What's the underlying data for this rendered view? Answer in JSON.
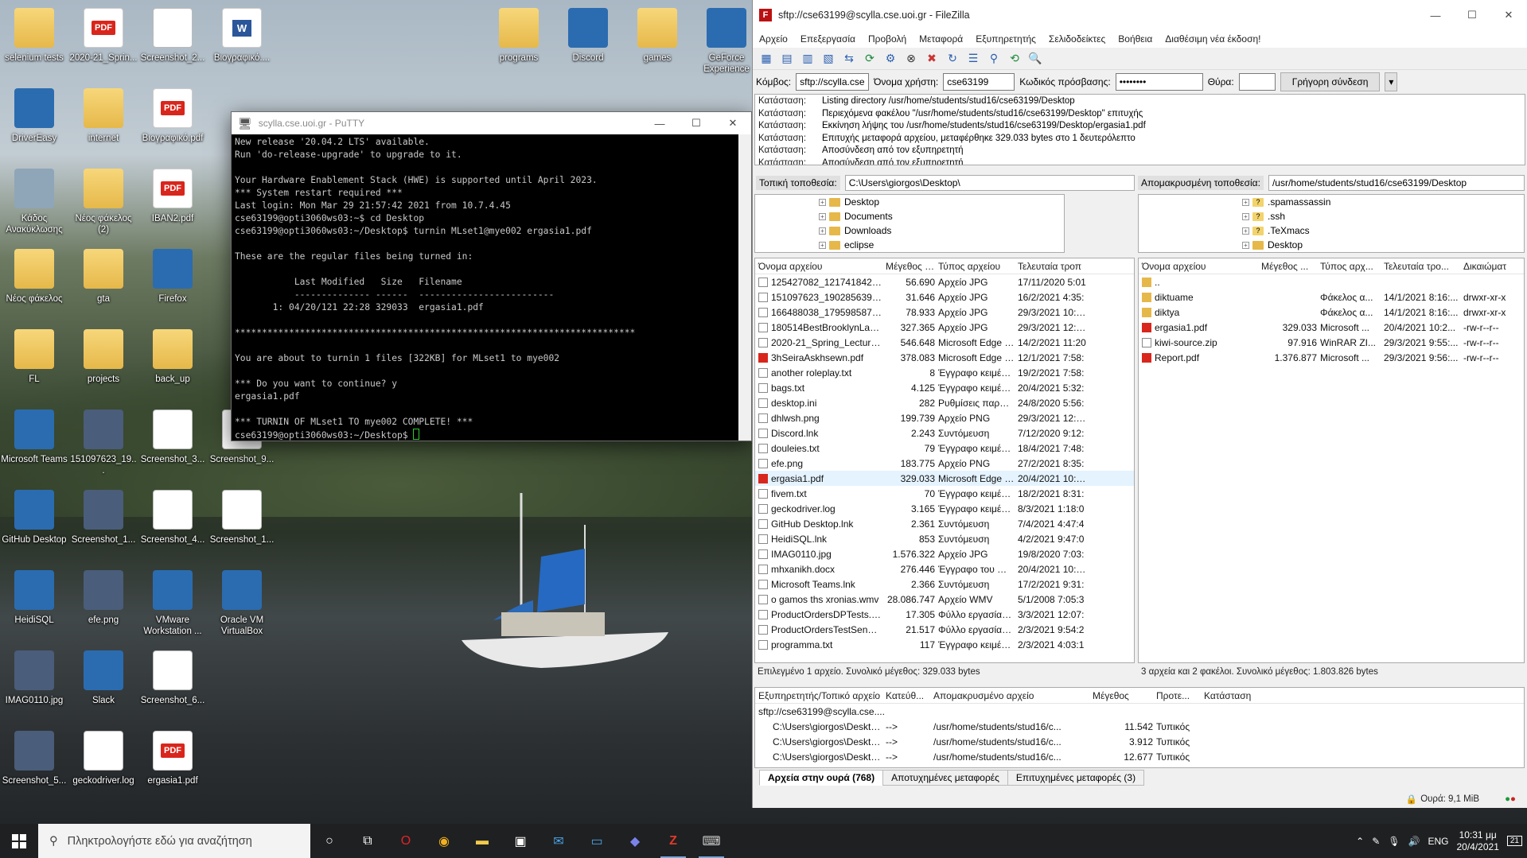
{
  "desktop": {
    "icons": [
      {
        "label": "selenium tests",
        "type": "folder"
      },
      {
        "label": "2020-21_Sprin...",
        "type": "pdf"
      },
      {
        "label": "Screenshot_2...",
        "type": "doc"
      },
      {
        "label": "Βιογραφικό....",
        "type": "word"
      },
      {
        "label": "programs",
        "type": "folder"
      },
      {
        "label": "Discord",
        "type": "app"
      },
      {
        "label": "games",
        "type": "folder"
      },
      {
        "label": "GeForce Experience",
        "type": "app"
      },
      {
        "label": "DriverEasy",
        "type": "app"
      },
      {
        "label": "internet",
        "type": "folder"
      },
      {
        "label": "Βιογραφικό.pdf",
        "type": "pdf"
      },
      {
        "label": "Κάδος Ανακύκλωσης",
        "type": "bin"
      },
      {
        "label": "Νέος φάκελος (2)",
        "type": "folder"
      },
      {
        "label": "IBAN2.pdf",
        "type": "pdf"
      },
      {
        "label": "Νέος φάκελος",
        "type": "folder"
      },
      {
        "label": "gta",
        "type": "folder"
      },
      {
        "label": "Firefox",
        "type": "app"
      },
      {
        "label": "FL",
        "type": "folder"
      },
      {
        "label": "projects",
        "type": "folder"
      },
      {
        "label": "back_up",
        "type": "folder"
      },
      {
        "label": "Microsoft Teams",
        "type": "app"
      },
      {
        "label": "151097623_19...",
        "type": "img"
      },
      {
        "label": "Screenshot_3...",
        "type": "doc"
      },
      {
        "label": "Screenshot_9...",
        "type": "doc"
      },
      {
        "label": "GitHub Desktop",
        "type": "app"
      },
      {
        "label": "Screenshot_1...",
        "type": "img"
      },
      {
        "label": "Screenshot_4...",
        "type": "doc"
      },
      {
        "label": "Screenshot_1...",
        "type": "doc"
      },
      {
        "label": "HeidiSQL",
        "type": "app"
      },
      {
        "label": "efe.png",
        "type": "img"
      },
      {
        "label": "VMware Workstation ...",
        "type": "app"
      },
      {
        "label": "Oracle VM VirtualBox",
        "type": "app"
      },
      {
        "label": "IMAG0110.jpg",
        "type": "img"
      },
      {
        "label": "Slack",
        "type": "app"
      },
      {
        "label": "Screenshot_6...",
        "type": "doc"
      },
      {
        "label": "Screenshot_5...",
        "type": "img"
      },
      {
        "label": "geckodriver.log",
        "type": "doc"
      },
      {
        "label": "ergasia1.pdf",
        "type": "pdf"
      }
    ]
  },
  "putty": {
    "title": "scylla.cse.uoi.gr - PuTTY",
    "lines": [
      "New release '20.04.2 LTS' available.",
      "Run 'do-release-upgrade' to upgrade to it.",
      "",
      "Your Hardware Enablement Stack (HWE) is supported until April 2023.",
      "*** System restart required ***",
      "Last login: Mon Mar 29 21:57:42 2021 from 10.7.4.45",
      "cse63199@opti3060ws03:~$ cd Desktop",
      "cse63199@opti3060ws03:~/Desktop$ turnin MLset1@mye002 ergasia1.pdf",
      "",
      "These are the regular files being turned in:",
      "",
      "           Last Modified   Size   Filename",
      "           -------------- ------  -------------------------",
      "       1: 04/20/121 22:28 329033  ergasia1.pdf",
      "",
      "**************************************************************************",
      "",
      "You are about to turnin 1 files [322KB] for MLset1 to mye002",
      "",
      "*** Do you want to continue? y",
      "ergasia1.pdf",
      "",
      "*** TURNIN OF MLset1 TO mye002 COMPLETE! ***"
    ],
    "prompt": "cse63199@opti3060ws03:~/Desktop$ "
  },
  "filezilla": {
    "title": "sftp://cse63199@scylla.cse.uoi.gr - FileZilla",
    "menu": [
      "Αρχείο",
      "Επεξεργασία",
      "Προβολή",
      "Μεταφορά",
      "Εξυπηρετητής",
      "Σελιδοδείκτες",
      "Βοήθεια",
      "Διαθέσιμη νέα έκδοση!"
    ],
    "quickconnect": {
      "host_label": "Κόμβος:",
      "host_value": "sftp://scylla.cse.uoi",
      "user_label": "Όνομα χρήστη:",
      "user_value": "cse63199",
      "pass_label": "Κωδικός πρόσβασης:",
      "pass_value": "••••••••",
      "port_label": "Θύρα:",
      "port_value": "",
      "button": "Γρήγορη σύνδεση"
    },
    "log": [
      [
        "Κατάσταση:",
        "Listing directory /usr/home/students/stud16/cse63199/Desktop"
      ],
      [
        "Κατάσταση:",
        "Περιεχόμενα φακέλου \"/usr/home/students/stud16/cse63199/Desktop\" επιτυχής"
      ],
      [
        "Κατάσταση:",
        "Εκκίνηση λήψης του /usr/home/students/stud16/cse63199/Desktop/ergasia1.pdf"
      ],
      [
        "Κατάσταση:",
        "Επιτυχής μεταφορά αρχείου, μεταφέρθηκε 329.033 bytes στο 1 δευτερόλεπτο"
      ],
      [
        "Κατάσταση:",
        "Αποσύνδεση από τον εξυπηρετητή"
      ],
      [
        "Κατάσταση:",
        "Αποσύνδεση από τον εξυπηρετητή"
      ]
    ],
    "local": {
      "path_label": "Τοπική τοποθεσία:",
      "path": "C:\\Users\\giorgos\\Desktop\\",
      "tree": [
        "Desktop",
        "Documents",
        "Downloads",
        "eclipse"
      ],
      "headers": [
        "Όνομα αρχείου",
        "Μέγεθος α...",
        "Τύπος αρχείου",
        "Τελευταία τροπ"
      ],
      "files": [
        [
          "125427082_1217418425306...",
          "56.690",
          "Αρχείο JPG",
          "17/11/2020 5:01"
        ],
        [
          "151097623_1902856393198...",
          "31.646",
          "Αρχείο JPG",
          "16/2/2021 4:35:"
        ],
        [
          "166488038_1795985870593...",
          "78.933",
          "Αρχείο JPG",
          "29/3/2021 10:23"
        ],
        [
          "180514BestBrooklynLandl...",
          "327.365",
          "Αρχείο JPG",
          "29/3/2021 12:45"
        ],
        [
          "2020-21_Spring_Lectures-...",
          "546.648",
          "Microsoft Edge PD...",
          "14/2/2021 11:20"
        ],
        [
          "3hSeiraAskhsewn.pdf",
          "378.083",
          "Microsoft Edge PD...",
          "12/1/2021 7:58:"
        ],
        [
          "another roleplay.txt",
          "8",
          "Έγγραφο κειμένου",
          "19/2/2021 7:58:"
        ],
        [
          "bags.txt",
          "4.125",
          "Έγγραφο κειμένου",
          "20/4/2021 5:32:"
        ],
        [
          "desktop.ini",
          "282",
          "Ρυθμίσεις παραμέ...",
          "24/8/2020 5:56:"
        ],
        [
          "dhlwsh.png",
          "199.739",
          "Αρχείο PNG",
          "29/3/2021 12:25"
        ],
        [
          "Discord.lnk",
          "2.243",
          "Συντόμευση",
          "7/12/2020 9:12:"
        ],
        [
          "douleies.txt",
          "79",
          "Έγγραφο κειμένου",
          "18/4/2021 7:48:"
        ],
        [
          "efe.png",
          "183.775",
          "Αρχείο PNG",
          "27/2/2021 8:35:"
        ],
        [
          "ergasia1.pdf",
          "329.033",
          "Microsoft Edge PD...",
          "20/4/2021 10:28"
        ],
        [
          "fivem.txt",
          "70",
          "Έγγραφο κειμένου",
          "18/2/2021 8:31:"
        ],
        [
          "geckodriver.log",
          "3.165",
          "Έγγραφο κειμένου",
          "8/3/2021 1:18:0"
        ],
        [
          "GitHub Desktop.lnk",
          "2.361",
          "Συντόμευση",
          "7/4/2021 4:47:4"
        ],
        [
          "HeidiSQL.lnk",
          "853",
          "Συντόμευση",
          "4/2/2021 9:47:0"
        ],
        [
          "IMAG0110.jpg",
          "1.576.322",
          "Αρχείο JPG",
          "19/8/2020 7:03:"
        ],
        [
          "mhxanikh.docx",
          "276.446",
          "Έγγραφο του Micr...",
          "20/4/2021 10:14"
        ],
        [
          "Microsoft Teams.lnk",
          "2.366",
          "Συντόμευση",
          "17/2/2021 9:31:"
        ],
        [
          "o gamos ths xronias.wmv",
          "28.086.747",
          "Αρχείο WMV",
          "5/1/2008 7:05:3"
        ],
        [
          "ProductOrdersDPTests.xlsx",
          "17.305",
          "Φύλλο εργασίας τ...",
          "3/3/2021 12:07:"
        ],
        [
          "ProductOrdersTestSenario...",
          "21.517",
          "Φύλλο εργασίας τ...",
          "2/3/2021 9:54:2"
        ],
        [
          "programma.txt",
          "117",
          "Έγγραφο κειμένου",
          "2/3/2021 4:03:1"
        ]
      ],
      "status": "Επιλεγμένο 1 αρχείο. Συνολικό μέγεθος: 329.033 bytes"
    },
    "remote": {
      "path_label": "Απομακρυσμένη τοποθεσία:",
      "path": "/usr/home/students/stud16/cse63199/Desktop",
      "tree": [
        ".spamassassin",
        ".ssh",
        ".TeXmacs",
        "Desktop"
      ],
      "headers": [
        "Όνομα αρχείου",
        "Μέγεθος ...",
        "Τύπος αρχ...",
        "Τελευταία τρο...",
        "Δικαιώματ"
      ],
      "files": [
        [
          "..",
          "",
          "",
          "",
          ""
        ],
        [
          "diktuame",
          "",
          "Φάκελος α...",
          "14/1/2021 8:16:...",
          "drwxr-xr-x"
        ],
        [
          "diktya",
          "",
          "Φάκελος α...",
          "14/1/2021 8:16:...",
          "drwxr-xr-x"
        ],
        [
          "ergasia1.pdf",
          "329.033",
          "Microsoft ...",
          "20/4/2021 10:2...",
          "-rw-r--r--"
        ],
        [
          "kiwi-source.zip",
          "97.916",
          "WinRAR ZI...",
          "29/3/2021 9:55:...",
          "-rw-r--r--"
        ],
        [
          "Report.pdf",
          "1.376.877",
          "Microsoft ...",
          "29/3/2021 9:56:...",
          "-rw-r--r--"
        ]
      ],
      "status": "3 αρχεία και 2 φακέλοι. Συνολικό μέγεθος: 1.803.826 bytes"
    },
    "queue": {
      "headers": [
        "Εξυπηρετητής/Τοπικό αρχείο",
        "Κατεύθ...",
        "Απομακρυσμένο αρχείο",
        "Μέγεθος",
        "Προτε...",
        "Κατάσταση"
      ],
      "server": "sftp://cse63199@scylla.cse....",
      "rows": [
        [
          "C:\\Users\\giorgos\\Desktop...",
          "-->",
          "/usr/home/students/stud16/c...",
          "11.542",
          "Τυπικός"
        ],
        [
          "C:\\Users\\giorgos\\Desktop...",
          "-->",
          "/usr/home/students/stud16/c...",
          "3.912",
          "Τυπικός"
        ],
        [
          "C:\\Users\\giorgos\\Desktop...",
          "-->",
          "/usr/home/students/stud16/c...",
          "12.677",
          "Τυπικός"
        ]
      ],
      "tabs": [
        "Αρχεία στην ουρά (768)",
        "Αποτυχημένες μεταφορές",
        "Επιτυχημένες μεταφορές (3)"
      ],
      "queue_size": "Ουρά: 9,1 MiB"
    }
  },
  "taskbar": {
    "search_placeholder": "Πληκτρολογήστε εδώ για αναζήτηση",
    "lang": "ENG",
    "time": "10:31 μμ",
    "date": "20/4/2021",
    "notifications": "21"
  }
}
